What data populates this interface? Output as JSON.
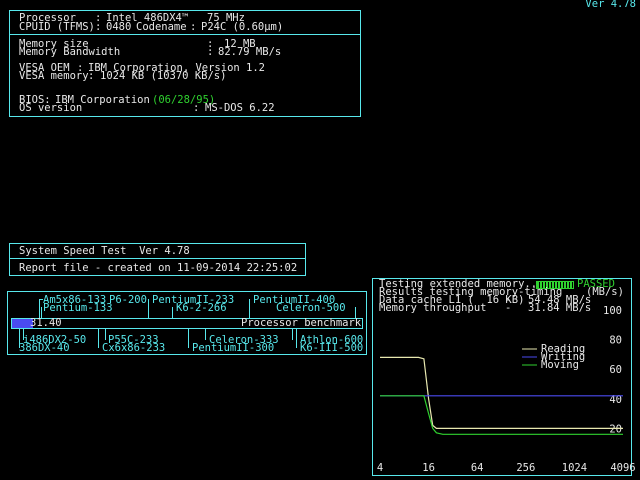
{
  "version": "Ver 4.78",
  "sysinfo": {
    "processor_label": "Processor",
    "processor_value": "Intel 486DX4™",
    "processor_speed": "75 MHz",
    "cpuid_label": "CPUID (TFMS)",
    "cpuid_value": "0480",
    "codename_label": "Codename",
    "codename_value": "P24C (0.60µm)",
    "memsize_label": "Memory size",
    "memsize_value": "12 MB",
    "membw_label": "Memory Bandwidth",
    "membw_value": "82.79 MB/s",
    "vesa_oem_label": "VESA OEM",
    "vesa_oem_value": "IBM Corporation, Version 1.2",
    "vesa_mem_label": "VESA memory",
    "vesa_mem_value": "1024 KB (10370 KB/s)",
    "bios_label": "BIOS:",
    "bios_value": "IBM Corporation",
    "bios_date": "(06/28/95)",
    "os_label": "OS version",
    "os_value": "MS-DOS 6.22"
  },
  "speedtest": {
    "title": "System Speed Test  Ver 4.78",
    "report": "Report file - created on 11-09-2014 22:25:02"
  },
  "benchmark": {
    "score": "31.40",
    "score_fraction": 0.06,
    "caption": "Processor benchmark",
    "top_row1": [
      "Am5x86-133",
      "P6-200",
      "PentiumII-233",
      "PentiumII-400"
    ],
    "top_row2": [
      "Pentium-133",
      "K6-2-266",
      "Celeron-500"
    ],
    "bottom_row1": [
      "i486DX2-50",
      "P55C-233",
      "Celeron-333",
      "Athlon-600"
    ],
    "bottom_row2": [
      "386DX-40",
      "Cx6x86-233",
      "PentiumII-300",
      "K6-III-500"
    ]
  },
  "memtest": {
    "testing_text": "Testing extended memory...",
    "passed_text": "PASSED",
    "results_text": "Results testing memory-timing",
    "unit_text": "(MB/s)",
    "l1_label": "Data cache L1 (  16 KB)",
    "l1_value": "54.48 MB/s",
    "thr_label": "Memory throughput",
    "thr_value": "31.84 MB/s"
  },
  "chart_data": {
    "type": "line",
    "x": [
      4,
      8,
      12,
      14,
      16,
      18,
      20,
      24,
      32,
      64,
      128,
      256,
      512,
      1024,
      2048,
      4096
    ],
    "x_ticks": [
      "4",
      "16",
      "64",
      "256",
      "1024",
      "4096"
    ],
    "y_ticks": [
      "100",
      "80",
      "60",
      "40",
      "20"
    ],
    "ylim": [
      0,
      100
    ],
    "xscale": "log2",
    "grid": false,
    "legend_position": "right",
    "series": [
      {
        "name": "Reading",
        "color": "#e8e8b0",
        "values": [
          68,
          68,
          68,
          67,
          40,
          22,
          20,
          20,
          20,
          20,
          20,
          20,
          20,
          20,
          20,
          20
        ]
      },
      {
        "name": "Writing",
        "color": "#4a4af0",
        "values": [
          42,
          42,
          42,
          42,
          42,
          42,
          42,
          42,
          42,
          42,
          42,
          42,
          42,
          42,
          42,
          42
        ]
      },
      {
        "name": "Moving",
        "color": "#2fd12f",
        "values": [
          42,
          42,
          42,
          42,
          30,
          20,
          17,
          16,
          16,
          16,
          16,
          16,
          16,
          16,
          16,
          16
        ]
      }
    ]
  }
}
